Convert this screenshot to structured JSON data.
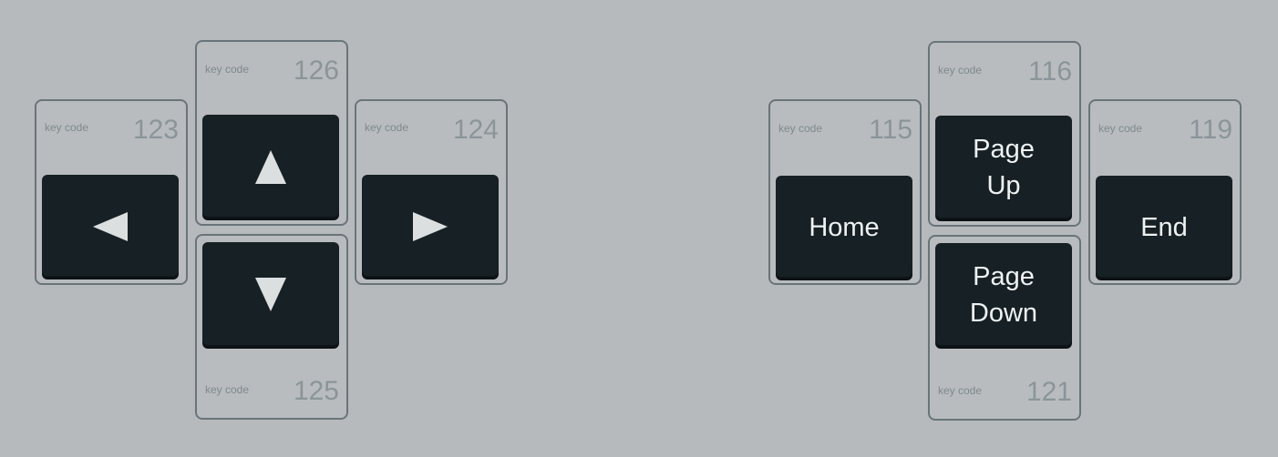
{
  "keycode_label": "key code",
  "arrow_keys": {
    "up": {
      "code": "126",
      "icon": "arrow-up-icon"
    },
    "down": {
      "code": "125",
      "icon": "arrow-down-icon"
    },
    "left": {
      "code": "123",
      "icon": "arrow-left-icon"
    },
    "right": {
      "code": "124",
      "icon": "arrow-right-icon"
    }
  },
  "nav_keys": {
    "home": {
      "code": "115",
      "label": "Home"
    },
    "page_up": {
      "code": "116",
      "label": "Page\nUp"
    },
    "end": {
      "code": "119",
      "label": "End"
    },
    "page_down": {
      "code": "121",
      "label": "Page\nDown"
    }
  },
  "colors": {
    "background": "#b7babc",
    "frame_border": "#69747a",
    "key_face": "#172024",
    "key_text": "#eef2f3",
    "keycode_text": "#8a9599"
  }
}
